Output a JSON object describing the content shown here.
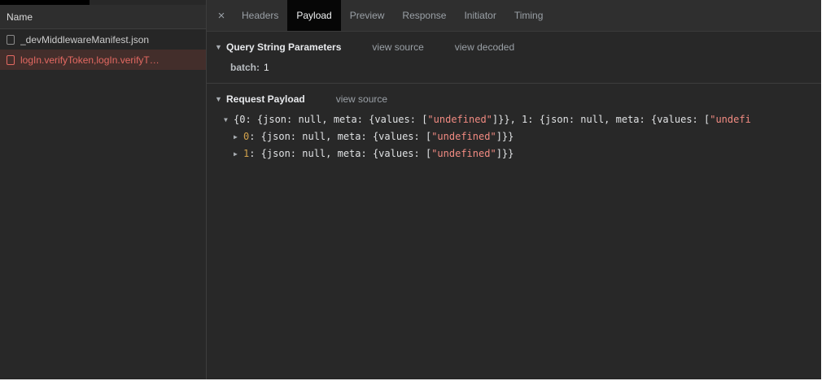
{
  "icons": {
    "expanded": "▼",
    "collapsed": "▶",
    "close": "×"
  },
  "colors": {
    "error_red": "#e46962",
    "string_color": "#f28b82",
    "key_color": "#d2a24c",
    "selected_tab_bg": "#060606",
    "panel_bg": "#282828"
  },
  "sidebar": {
    "header": "Name",
    "rows": [
      {
        "label": "_devMiddlewareManifest.json",
        "status": "normal"
      },
      {
        "label": "logIn.verifyToken,logIn.verifyT…",
        "status": "error-selected"
      }
    ]
  },
  "tabs": {
    "items": [
      {
        "label": "Headers"
      },
      {
        "label": "Payload"
      },
      {
        "label": "Preview"
      },
      {
        "label": "Response"
      },
      {
        "label": "Initiator"
      },
      {
        "label": "Timing"
      }
    ],
    "active": "Payload"
  },
  "query_string": {
    "title": "Query String Parameters",
    "view_source": "view source",
    "view_decoded": "view decoded",
    "params": [
      {
        "name": "batch:",
        "value": "1"
      }
    ]
  },
  "request_payload": {
    "title": "Request Payload",
    "view_source": "view source",
    "tree": {
      "root": [
        {
          "c": "p",
          "t": "{0: {json: null, meta: {values: ["
        },
        {
          "c": "s",
          "t": "\"undefined\""
        },
        {
          "c": "p",
          "t": "]}}, 1: {json: null, meta: {values: ["
        },
        {
          "c": "s",
          "t": "\"undefi"
        }
      ],
      "children": [
        [
          {
            "c": "k",
            "t": "0"
          },
          {
            "c": "p",
            "t": ": {json: null, meta: {values: ["
          },
          {
            "c": "s",
            "t": "\"undefined\""
          },
          {
            "c": "p",
            "t": "]}}"
          }
        ],
        [
          {
            "c": "k",
            "t": "1"
          },
          {
            "c": "p",
            "t": ": {json: null, meta: {values: ["
          },
          {
            "c": "s",
            "t": "\"undefined\""
          },
          {
            "c": "p",
            "t": "]}}"
          }
        ]
      ]
    }
  }
}
